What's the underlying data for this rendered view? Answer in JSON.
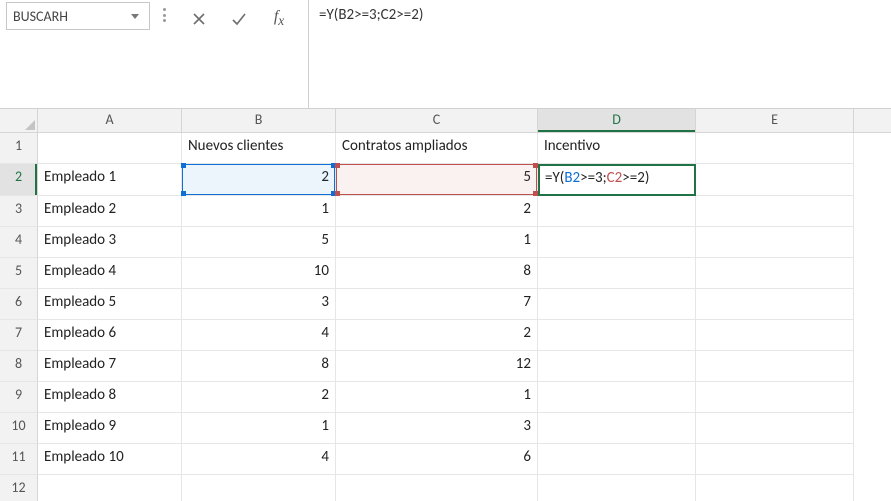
{
  "name_box": "BUSCARH",
  "formula_bar": {
    "prefix": "=Y(",
    "ref1": "B2",
    "mid1": ">=3;",
    "ref2": "C2",
    "mid2": ">=2)"
  },
  "columns": [
    "A",
    "B",
    "C",
    "D",
    "E"
  ],
  "active_column": "D",
  "row_headers": [
    1,
    2,
    3,
    4,
    5,
    6,
    7,
    8,
    9,
    10,
    11,
    12
  ],
  "active_row": 2,
  "headers": {
    "b1": "Nuevos clientes",
    "c1": "Contratos ampliados",
    "d1": "Incentivo"
  },
  "rows": [
    {
      "a": "Empleado 1",
      "b": 2,
      "c": 5
    },
    {
      "a": "Empleado 2",
      "b": 1,
      "c": 2
    },
    {
      "a": "Empleado 3",
      "b": 5,
      "c": 1
    },
    {
      "a": "Empleado 4",
      "b": 10,
      "c": 8
    },
    {
      "a": "Empleado 5",
      "b": 3,
      "c": 7
    },
    {
      "a": "Empleado 6",
      "b": 4,
      "c": 2
    },
    {
      "a": "Empleado 7",
      "b": 8,
      "c": 12
    },
    {
      "a": "Empleado 8",
      "b": 2,
      "c": 1
    },
    {
      "a": "Empleado 9",
      "b": 1,
      "c": 3
    },
    {
      "a": "Empleado 10",
      "b": 4,
      "c": 6
    }
  ],
  "editing_cell": {
    "prefix": "=Y(",
    "ref1": "B2",
    "mid1": ">=3;",
    "ref2": "C2",
    "mid2": ">=2)"
  }
}
